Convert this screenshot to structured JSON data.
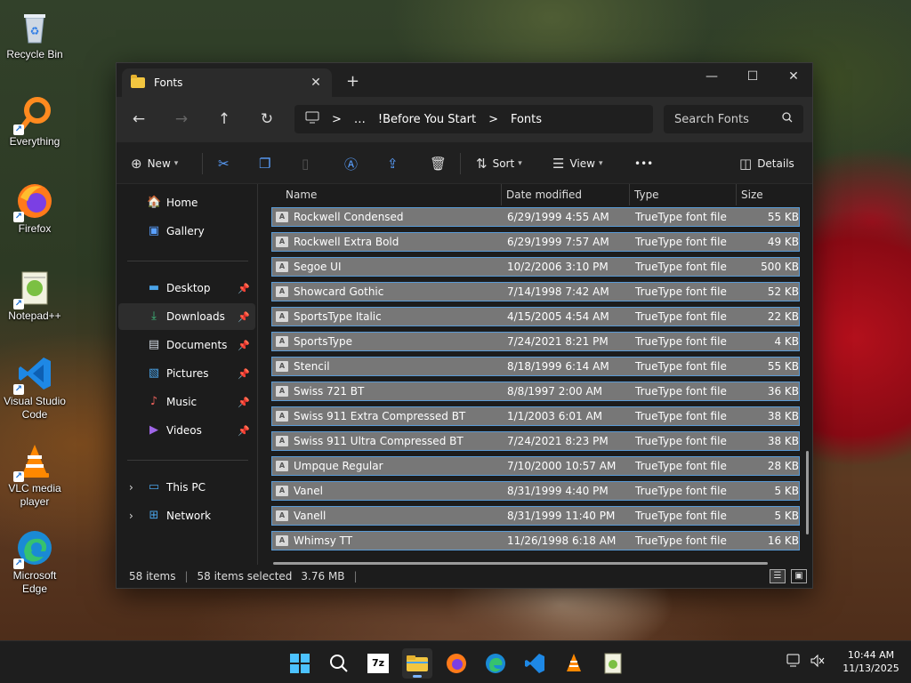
{
  "desktop": {
    "icons": [
      {
        "label": "Recycle Bin"
      },
      {
        "label": "Everything"
      },
      {
        "label": "Firefox"
      },
      {
        "label": "Notepad++"
      },
      {
        "label": "Visual Studio Code"
      },
      {
        "label": "VLC media player"
      },
      {
        "label": "Microsoft Edge"
      }
    ]
  },
  "window": {
    "tab_title": "Fonts",
    "new_tab": "+",
    "controls": {
      "minimize": "—",
      "maximize": "☐",
      "close": "✕"
    },
    "breadcrumb": [
      "…",
      "!Before You Start",
      "Fonts"
    ],
    "breadcrumb_sep": ">",
    "search_placeholder": "Search Fonts",
    "toolbar": {
      "new": "New",
      "sort": "Sort",
      "view": "View",
      "more": "•••",
      "details": "Details"
    },
    "nav": {
      "home": "Home",
      "gallery": "Gallery",
      "desktop": "Desktop",
      "downloads": "Downloads",
      "documents": "Documents",
      "pictures": "Pictures",
      "music": "Music",
      "videos": "Videos",
      "this_pc": "This PC",
      "network": "Network"
    },
    "columns": {
      "name": "Name",
      "date": "Date modified",
      "type": "Type",
      "size": "Size"
    },
    "files": [
      {
        "name": "Rockwell Condensed",
        "date": "6/29/1999 4:55 AM",
        "type": "TrueType font file",
        "size": "55 KB"
      },
      {
        "name": "Rockwell Extra Bold",
        "date": "6/29/1999 7:57 AM",
        "type": "TrueType font file",
        "size": "49 KB"
      },
      {
        "name": "Segoe UI",
        "date": "10/2/2006 3:10 PM",
        "type": "TrueType font file",
        "size": "500 KB"
      },
      {
        "name": "Showcard Gothic",
        "date": "7/14/1998 7:42 AM",
        "type": "TrueType font file",
        "size": "52 KB"
      },
      {
        "name": "SportsType Italic",
        "date": "4/15/2005 4:54 AM",
        "type": "TrueType font file",
        "size": "22 KB"
      },
      {
        "name": "SportsType",
        "date": "7/24/2021 8:21 PM",
        "type": "TrueType font file",
        "size": "4 KB"
      },
      {
        "name": "Stencil",
        "date": "8/18/1999 6:14 AM",
        "type": "TrueType font file",
        "size": "55 KB"
      },
      {
        "name": "Swiss 721 BT",
        "date": "8/8/1997 2:00 AM",
        "type": "TrueType font file",
        "size": "36 KB"
      },
      {
        "name": "Swiss 911 Extra Compressed BT",
        "date": "1/1/2003 6:01 AM",
        "type": "TrueType font file",
        "size": "38 KB"
      },
      {
        "name": "Swiss 911 Ultra Compressed BT",
        "date": "7/24/2021 8:23 PM",
        "type": "TrueType font file",
        "size": "38 KB"
      },
      {
        "name": "Umpque Regular",
        "date": "7/10/2000 10:57 AM",
        "type": "TrueType font file",
        "size": "28 KB"
      },
      {
        "name": "Vanel",
        "date": "8/31/1999 4:40 PM",
        "type": "TrueType font file",
        "size": "5 KB"
      },
      {
        "name": "Vanell",
        "date": "8/31/1999 11:40 PM",
        "type": "TrueType font file",
        "size": "5 KB"
      },
      {
        "name": "Whimsy TT",
        "date": "11/26/1998 6:18 AM",
        "type": "TrueType font file",
        "size": "16 KB"
      }
    ],
    "status": {
      "items": "58 items",
      "selected": "58 items selected",
      "size": "3.76 MB"
    }
  },
  "taskbar": {
    "time": "10:44 AM",
    "date": "11/13/2025"
  },
  "colors": {
    "accent": "#5aa0ff",
    "selection": "#777777",
    "selection_border": "#5a9bd6"
  }
}
